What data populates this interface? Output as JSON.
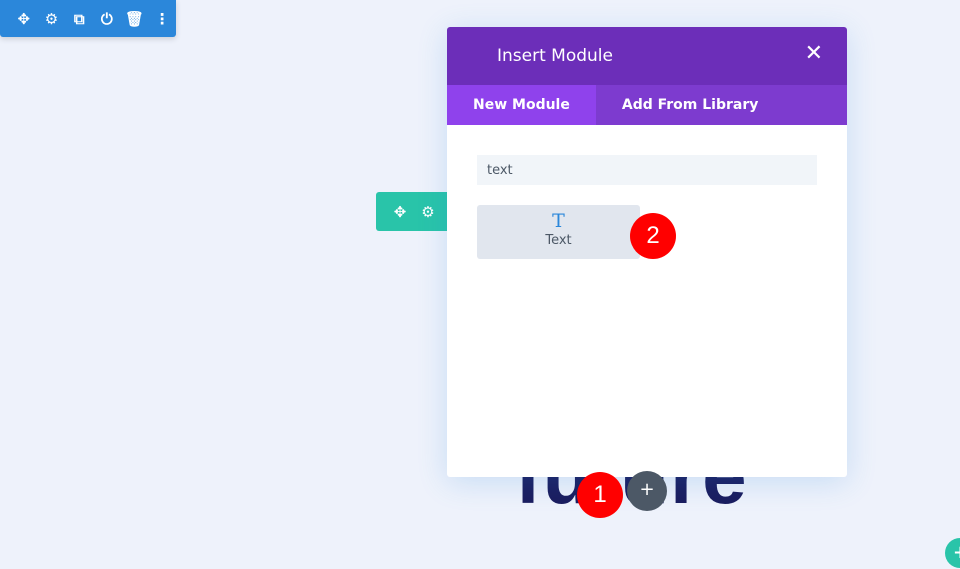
{
  "section_toolbar": {
    "icons": [
      "move-icon",
      "gear-icon",
      "duplicate-icon",
      "power-icon",
      "trash-icon",
      "more-icon"
    ],
    "color": "#2b87da"
  },
  "row_toolbar": {
    "icons": [
      "move-icon",
      "gear-icon"
    ],
    "color": "#29c4a9"
  },
  "background_text": "future",
  "modal": {
    "title": "Insert Module",
    "close": "✕",
    "tabs": [
      {
        "label": "New Module"
      },
      {
        "label": "Add From Library"
      }
    ],
    "search_value": "text",
    "modules": [
      {
        "icon": "T",
        "label": "Text"
      }
    ]
  },
  "badges": [
    "1",
    "2"
  ],
  "add_button": "+"
}
